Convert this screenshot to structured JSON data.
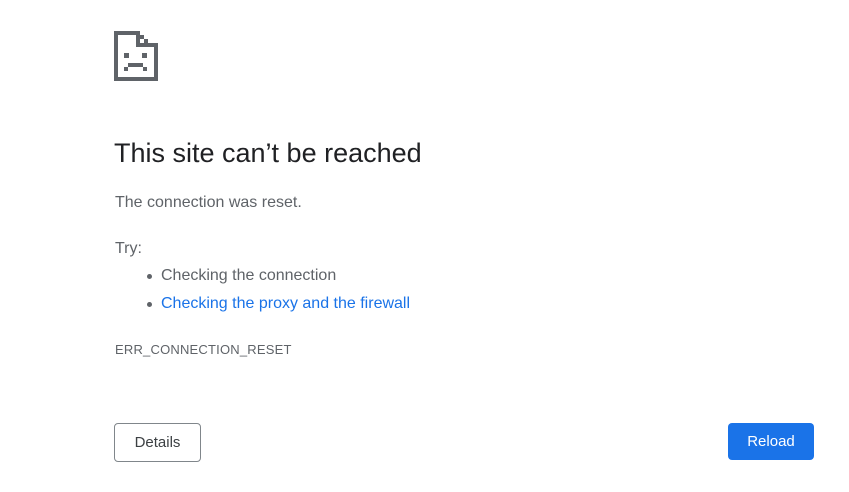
{
  "error_page": {
    "icon": "sad-document-icon",
    "title": "This site can’t be reached",
    "message": "The connection was reset.",
    "try_label": "Try:",
    "suggestions": [
      {
        "label": "Checking the connection",
        "is_link": false
      },
      {
        "label": "Checking the proxy and the firewall",
        "is_link": true
      }
    ],
    "error_code": "ERR_CONNECTION_RESET"
  },
  "buttons": {
    "details_label": "Details",
    "reload_label": "Reload"
  },
  "colors": {
    "accent": "#1a73e8",
    "text_primary": "#202124",
    "text_secondary": "#5f6368",
    "icon": "#5f6368"
  }
}
